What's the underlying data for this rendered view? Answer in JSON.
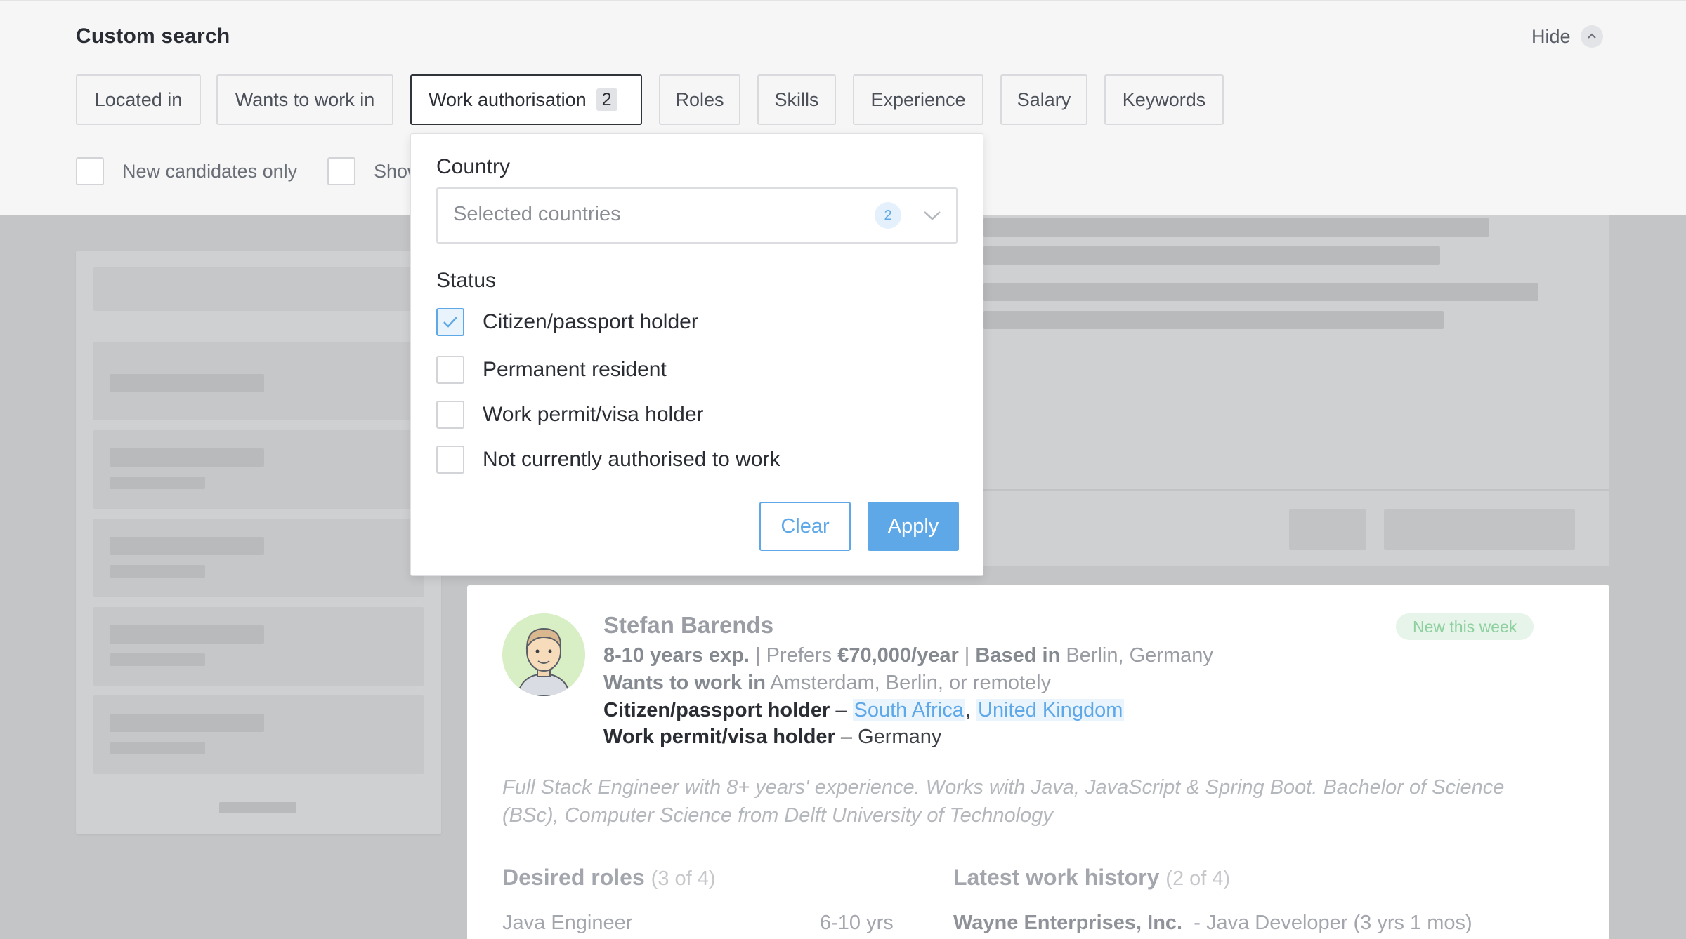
{
  "header": {
    "title": "Custom search",
    "hide_label": "Hide"
  },
  "filters": [
    {
      "label": "Located in"
    },
    {
      "label": "Wants to work in"
    },
    {
      "label": "Work authorisation",
      "count": "2"
    },
    {
      "label": "Roles"
    },
    {
      "label": "Skills"
    },
    {
      "label": "Experience"
    },
    {
      "label": "Salary"
    },
    {
      "label": "Keywords"
    }
  ],
  "options": {
    "new_candidates": "New candidates only",
    "second_partial": "Show"
  },
  "dropdown": {
    "country_label": "Country",
    "country_placeholder": "Selected countries",
    "country_count": "2",
    "status_label": "Status",
    "statuses": [
      {
        "label": "Citizen/passport holder",
        "checked": true
      },
      {
        "label": "Permanent resident",
        "checked": false
      },
      {
        "label": "Work permit/visa holder",
        "checked": false
      },
      {
        "label": "Not currently authorised to work",
        "checked": false
      }
    ],
    "clear_label": "Clear",
    "apply_label": "Apply"
  },
  "candidate": {
    "name": "Stefan Barends",
    "badge": "New this week",
    "experience": "8-10 years exp.",
    "prefers_label": "Prefers",
    "salary": "€70,000/year",
    "based_label": "Based in",
    "location": "Berlin, Germany",
    "wants_label": "Wants to work in",
    "wants_value": "Amsterdam, Berlin, or remotely",
    "citizen_label": "Citizen/passport holder",
    "citizen_countries": [
      "South Africa",
      "United Kingdom"
    ],
    "permit_label": "Work permit/visa holder",
    "permit_value": "Germany",
    "summary": "Full Stack Engineer with 8+ years' experience. Works with Java, JavaScript & Spring Boot. Bachelor of Science (BSc), Computer Science from Delft University of Technology",
    "roles_title": "Desired roles",
    "roles_count": "(3 of 4)",
    "history_title": "Latest work history",
    "history_count": "(2 of 4)",
    "role_1": "Java Engineer",
    "role_1_years": "6-10 yrs",
    "history_1_company": "Wayne Enterprises, Inc.",
    "history_1_role": "- Java Developer (3 yrs 1 mos)"
  },
  "colors": {
    "accent": "#5fa8e8",
    "badge_bg": "#e6f4ea",
    "badge_text": "#8fd0a0",
    "overlay": "#c4c5c7"
  }
}
